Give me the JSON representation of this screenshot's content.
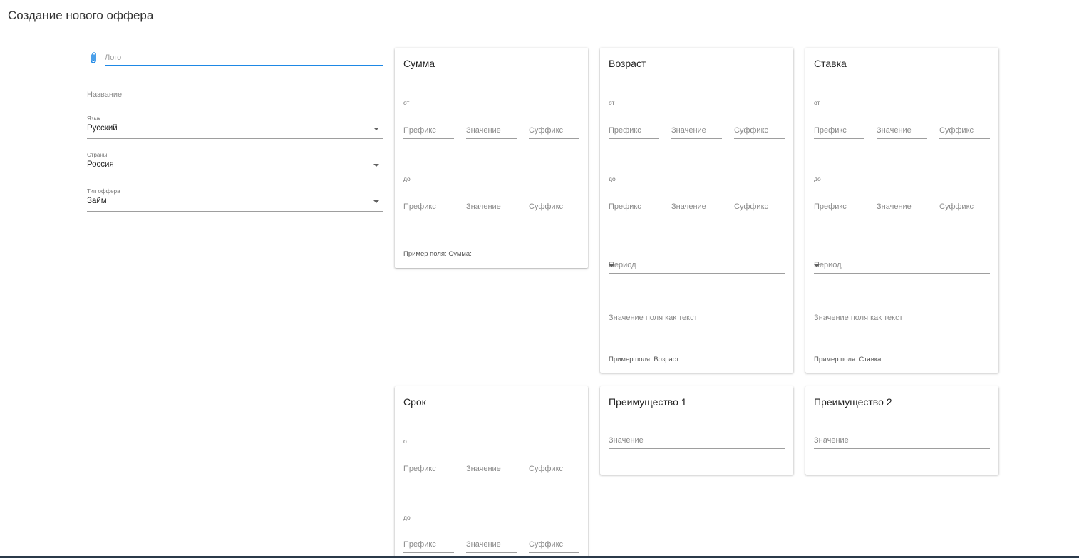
{
  "page": {
    "title": "Создание нового оффера"
  },
  "left_form": {
    "logo_placeholder": "Лого",
    "name_placeholder": "Название",
    "language": {
      "label": "Язык",
      "value": "Русский"
    },
    "countries": {
      "label": "Страны",
      "value": "Россия"
    },
    "offer_type": {
      "label": "Тип оффера",
      "value": "Займ"
    }
  },
  "common": {
    "from_label": "от",
    "to_label": "до",
    "prefix_placeholder": "Префикс",
    "value_placeholder": "Значение",
    "suffix_placeholder": "Суффикс",
    "period_placeholder": "Период",
    "text_value_placeholder": "Значение поля как текст"
  },
  "cards": {
    "sum": {
      "title": "Сумма",
      "example": "Пример поля: Сумма:"
    },
    "age": {
      "title": "Возраст",
      "example": "Пример поля: Возраст:"
    },
    "rate": {
      "title": "Ставка",
      "example": "Пример поля: Ставка:"
    },
    "term": {
      "title": "Срок"
    },
    "advantage1": {
      "title": "Преимущество 1",
      "value_placeholder": "Значение"
    },
    "advantage2": {
      "title": "Преимущество 2",
      "value_placeholder": "Значение"
    }
  },
  "colors": {
    "accent": "#1e88e5",
    "divider": "#9e9e9e"
  }
}
